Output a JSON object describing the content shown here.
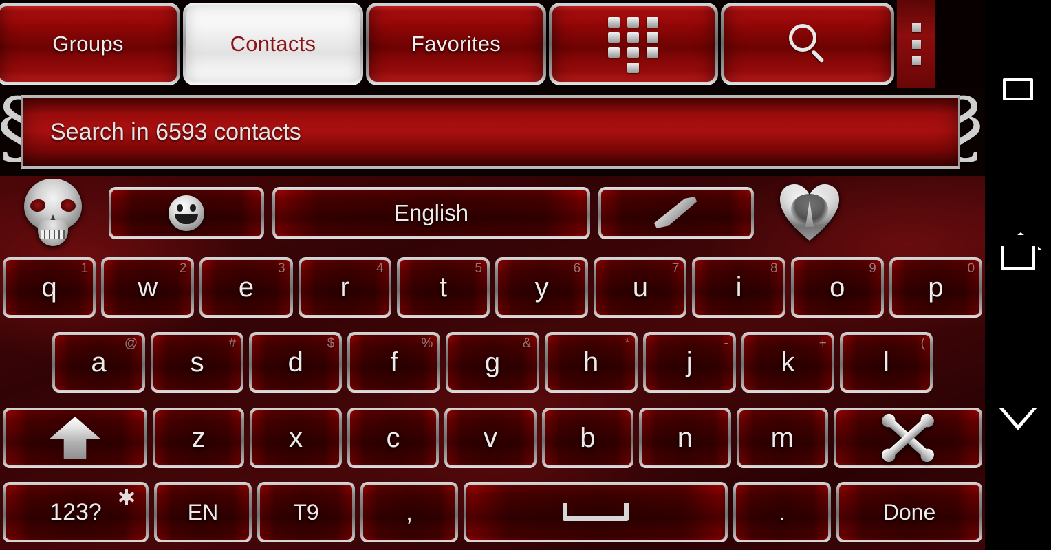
{
  "app": {
    "theme_accent": "#8d0606",
    "theme_silver": "#cfcfcf",
    "active_tab_text_color": "#8a1418"
  },
  "tabbar": {
    "tabs": [
      {
        "label": "Groups",
        "name": "tab-groups",
        "active": false
      },
      {
        "label": "Contacts",
        "name": "tab-contacts",
        "active": true
      },
      {
        "label": "Favorites",
        "name": "tab-favorites",
        "active": false
      }
    ],
    "dialpad_icon": "dialpad-icon",
    "search_icon": "search-icon",
    "overflow_icon": "overflow-menu-icon"
  },
  "search": {
    "placeholder": "Search in 6593 contacts",
    "value": "",
    "contact_count": "6593",
    "ornament_left": "scroll-ornament-icon",
    "ornament_right": "scroll-ornament-icon"
  },
  "keyboard": {
    "left_ornament": "skull-icon",
    "right_ornament": "heart-icon",
    "toolbar": {
      "emoji_label": "emoji-icon",
      "language_label": "English",
      "quill_label": "feather-icon"
    },
    "row1": [
      {
        "ch": "q",
        "sup": "1"
      },
      {
        "ch": "w",
        "sup": "2"
      },
      {
        "ch": "e",
        "sup": "3"
      },
      {
        "ch": "r",
        "sup": "4"
      },
      {
        "ch": "t",
        "sup": "5"
      },
      {
        "ch": "y",
        "sup": "6"
      },
      {
        "ch": "u",
        "sup": "7"
      },
      {
        "ch": "i",
        "sup": "8"
      },
      {
        "ch": "o",
        "sup": "9"
      },
      {
        "ch": "p",
        "sup": "0"
      }
    ],
    "row2": [
      {
        "ch": "a",
        "sup": "@"
      },
      {
        "ch": "s",
        "sup": "#"
      },
      {
        "ch": "d",
        "sup": "$"
      },
      {
        "ch": "f",
        "sup": "%"
      },
      {
        "ch": "g",
        "sup": "&"
      },
      {
        "ch": "h",
        "sup": "*"
      },
      {
        "ch": "j",
        "sup": "-"
      },
      {
        "ch": "k",
        "sup": "+"
      },
      {
        "ch": "l",
        "sup": "("
      }
    ],
    "row3": {
      "shift_label": "shift-icon",
      "letters": [
        {
          "ch": "z",
          "sup": ""
        },
        {
          "ch": "x",
          "sup": ""
        },
        {
          "ch": "c",
          "sup": ""
        },
        {
          "ch": "v",
          "sup": ""
        },
        {
          "ch": "b",
          "sup": ""
        },
        {
          "ch": "n",
          "sup": ""
        },
        {
          "ch": "m",
          "sup": ""
        }
      ],
      "backspace_label": "crossed-bones-backspace-icon"
    },
    "row4": {
      "symbols_label": "123?",
      "settings_icon": "gear-icon",
      "lang_label": "EN",
      "t9_label": "T9",
      "comma_label": ",",
      "space_label": "space-icon",
      "period_label": ".",
      "done_label": "Done"
    }
  },
  "navbar": {
    "recents_label": "recents-icon",
    "home_label": "home-icon",
    "back_label": "back-icon"
  }
}
